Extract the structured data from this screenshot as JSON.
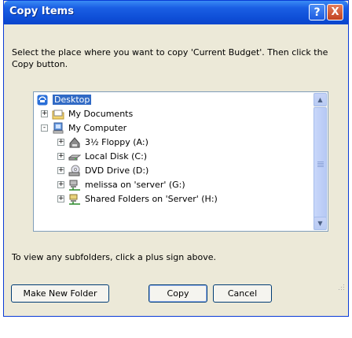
{
  "window": {
    "title": "Copy Items"
  },
  "titlebar": {
    "help_label": "?",
    "close_label": "X"
  },
  "instructions": "Select the place where you want to copy 'Current Budget'. Then click the Copy button.",
  "tree": {
    "items": [
      {
        "label": "Desktop",
        "expander": "",
        "icon": "desktop-icon",
        "selected": true
      },
      {
        "label": "My Documents",
        "expander": "+",
        "icon": "folder-icon"
      },
      {
        "label": "My Computer",
        "expander": "-",
        "icon": "computer-icon"
      },
      {
        "label": "3½ Floppy (A:)",
        "expander": "+",
        "icon": "floppy-icon"
      },
      {
        "label": "Local Disk (C:)",
        "expander": "+",
        "icon": "hard-disk-icon"
      },
      {
        "label": "DVD Drive (D:)",
        "expander": "+",
        "icon": "dvd-drive-icon"
      },
      {
        "label": "melissa on 'server' (G:)",
        "expander": "+",
        "icon": "network-drive-icon"
      },
      {
        "label": "Shared Folders on 'Server' (H:)",
        "expander": "+",
        "icon": "network-drive-icon"
      }
    ]
  },
  "hint": "To view any subfolders, click a plus sign above.",
  "buttons": {
    "new_folder": "Make New Folder",
    "copy": "Copy",
    "cancel": "Cancel"
  },
  "colors": {
    "titlebar": "#0a46cc",
    "selection": "#316ac5",
    "dialog_bg": "#ece9d8"
  }
}
